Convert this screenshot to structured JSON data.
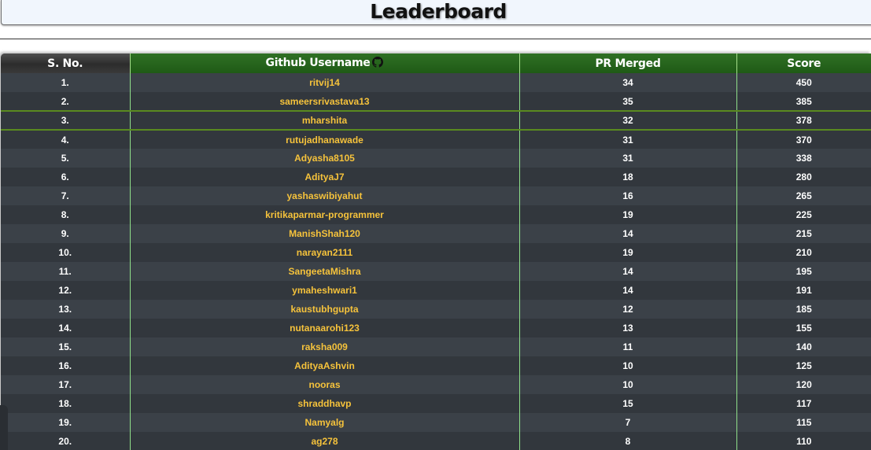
{
  "header": {
    "title": "Leaderboard"
  },
  "table": {
    "columns": {
      "sno": "S. No.",
      "username": "Github Username",
      "pr": "PR Merged",
      "score": "Score"
    },
    "rows": [
      {
        "sno": "1.",
        "username": "ritvij14",
        "pr": "34",
        "score": "450"
      },
      {
        "sno": "2.",
        "username": "sameersrivastava13",
        "pr": "35",
        "score": "385"
      },
      {
        "sno": "3.",
        "username": "mharshita",
        "pr": "32",
        "score": "378"
      },
      {
        "sno": "4.",
        "username": "rutujadhanawade",
        "pr": "31",
        "score": "370"
      },
      {
        "sno": "5.",
        "username": "Adyasha8105",
        "pr": "31",
        "score": "338"
      },
      {
        "sno": "6.",
        "username": "AdityaJ7",
        "pr": "18",
        "score": "280"
      },
      {
        "sno": "7.",
        "username": "yashaswibiyahut",
        "pr": "16",
        "score": "265"
      },
      {
        "sno": "8.",
        "username": "kritikaparmar-programmer",
        "pr": "19",
        "score": "225"
      },
      {
        "sno": "9.",
        "username": "ManishShah120",
        "pr": "14",
        "score": "215"
      },
      {
        "sno": "10.",
        "username": "narayan2111",
        "pr": "19",
        "score": "210"
      },
      {
        "sno": "11.",
        "username": "SangeetaMishra",
        "pr": "14",
        "score": "195"
      },
      {
        "sno": "12.",
        "username": "ymaheshwari1",
        "pr": "14",
        "score": "191"
      },
      {
        "sno": "13.",
        "username": "kaustubhgupta",
        "pr": "12",
        "score": "185"
      },
      {
        "sno": "14.",
        "username": "nutanaarohi123",
        "pr": "13",
        "score": "155"
      },
      {
        "sno": "15.",
        "username": "raksha009",
        "pr": "11",
        "score": "140"
      },
      {
        "sno": "16.",
        "username": "AdityaAshvin",
        "pr": "10",
        "score": "125"
      },
      {
        "sno": "17.",
        "username": "nooras",
        "pr": "10",
        "score": "120"
      },
      {
        "sno": "18.",
        "username": "shraddhavp",
        "pr": "15",
        "score": "117"
      },
      {
        "sno": "19.",
        "username": "Namyalg",
        "pr": "7",
        "score": "115"
      },
      {
        "sno": "20.",
        "username": "ag278",
        "pr": "8",
        "score": "110"
      }
    ]
  },
  "colors": {
    "header_green": "#2f7024",
    "username_gold": "#f5c23b",
    "row_dark": "#32373d",
    "row_light": "#3b4148"
  },
  "icons": {
    "github": "github-icon"
  }
}
